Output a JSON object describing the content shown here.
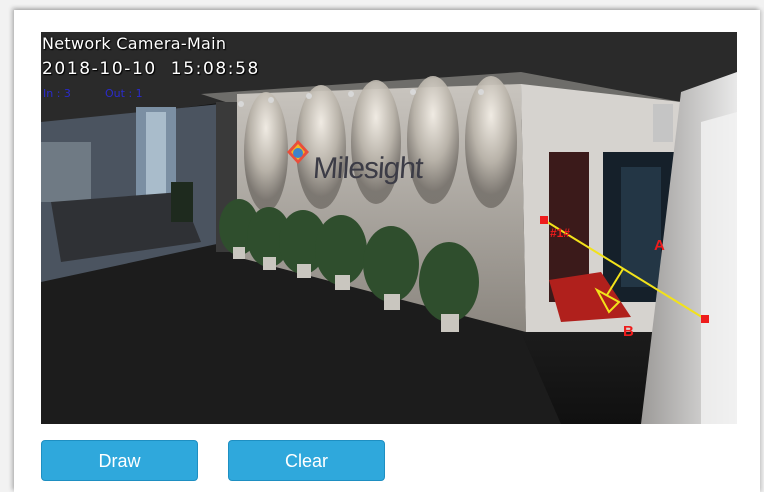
{
  "video": {
    "osd_title": "Network Camera-Main",
    "osd_timestamp": "2018-10-10  15:08:58",
    "osd_in_count": "In : 3",
    "osd_out_count": "Out : 1",
    "logo_text": "Milesight"
  },
  "counting_line": {
    "line_id": "#1#",
    "side_a_label": "A",
    "side_b_label": "B",
    "line_color": "#f2e21a",
    "endpoint_color": "#ee1c1c"
  },
  "buttons": {
    "draw_label": "Draw",
    "clear_label": "Clear"
  },
  "colors": {
    "button_bg": "#2fa8dc",
    "osd_counter_text": "#2a2acc"
  }
}
